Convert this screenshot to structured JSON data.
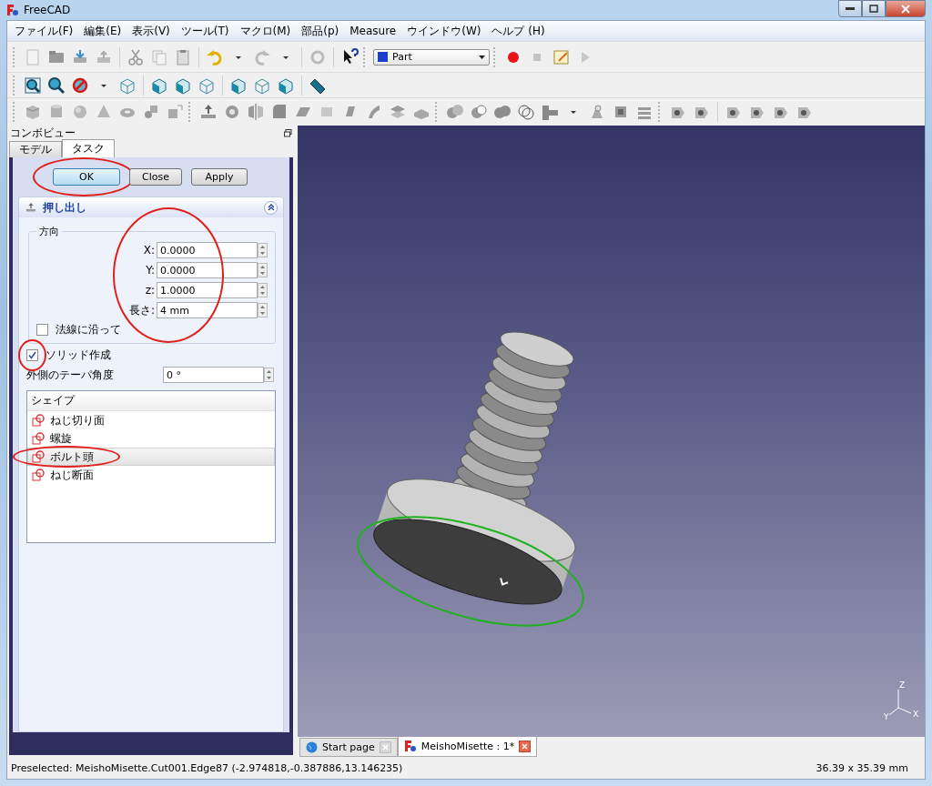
{
  "window": {
    "title": "FreeCAD"
  },
  "menu": [
    "ファイル(F)",
    "編集(E)",
    "表示(V)",
    "ツール(T)",
    "マクロ(M)",
    "部品(p)",
    "Measure",
    "ウインドウ(W)",
    "ヘルプ (H)"
  ],
  "toolbar": {
    "workbench": "Part"
  },
  "combo_view": {
    "title": "コンボビュー",
    "tabs": [
      {
        "label": "モデル",
        "selected": false
      },
      {
        "label": "タスク",
        "selected": true
      }
    ],
    "buttons": [
      {
        "label": "OK",
        "focused": true
      },
      {
        "label": "Close",
        "focused": false
      },
      {
        "label": "Apply",
        "focused": false
      }
    ],
    "panel": {
      "title": "押し出し",
      "expanded": true,
      "direction": {
        "title": "方向",
        "fields": [
          {
            "label": "X:",
            "value": "0.0000"
          },
          {
            "label": "Y:",
            "value": "0.0000"
          },
          {
            "label": "z:",
            "value": "1.0000"
          },
          {
            "label": "長さ:",
            "value": "4 mm"
          }
        ]
      },
      "along_normal": {
        "label": "法線に沿って",
        "checked": false
      },
      "create_solid": {
        "label": "ソリッド作成",
        "checked": true
      },
      "taper": {
        "label": "外側のテーパ角度",
        "value": "0 °"
      },
      "shapes": {
        "header": "シェイプ",
        "items": [
          {
            "label": "ねじ切り面",
            "selected": false
          },
          {
            "label": "螺旋",
            "selected": false
          },
          {
            "label": "ボルト頭",
            "selected": true
          },
          {
            "label": "ねじ断面",
            "selected": false
          }
        ]
      }
    }
  },
  "axis_labels": [
    "Z",
    "Y",
    "X"
  ],
  "document_tabs": [
    {
      "label": "Start page",
      "selected": false
    },
    {
      "label": "MeishoMisette : 1*",
      "selected": true
    }
  ],
  "status_bar": {
    "message": "Preselected: MeishoMisette.Cut001.Edge87 (-2.974818,-0.387886,13.146235)",
    "dimensions": "36.39 x 35.39 mm"
  }
}
